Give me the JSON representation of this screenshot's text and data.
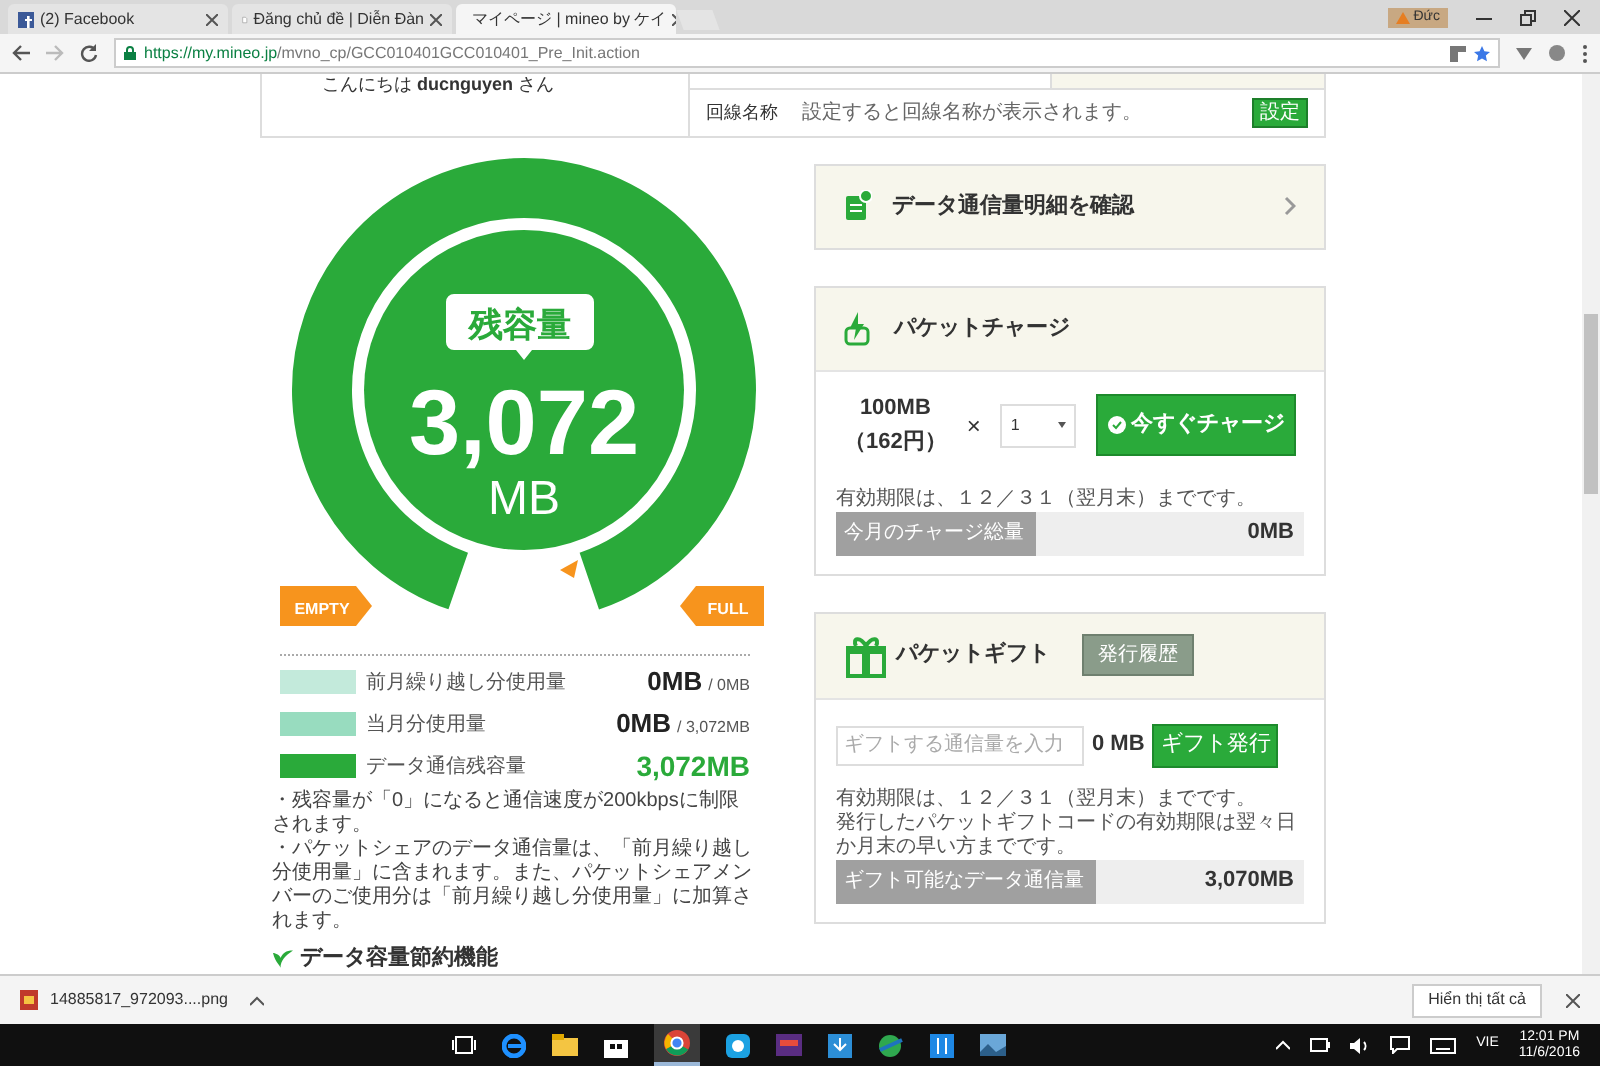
{
  "browser": {
    "tabs": [
      {
        "title": "(2) Facebook",
        "selected": false
      },
      {
        "title": "Đăng chủ đề | Diễn Đàn",
        "selected": false
      },
      {
        "title": "マイページ | mineo by ケイ",
        "selected": true
      }
    ],
    "profile": "Đức",
    "url_host": "https://my.mineo.jp",
    "url_path": "/mvno_cp/GCC010401GCC010401_Pre_Init.action"
  },
  "greeting": "こんにちは **ducnguyen** さん",
  "line_name": {
    "label": "回線名称",
    "value": "設定すると回線名称が表示されます。",
    "button": "設定"
  },
  "gauge": {
    "label": "残容量",
    "amount": "3,072",
    "unit": "MB",
    "empty": "EMPTY",
    "full": "FULL"
  },
  "legend": [
    {
      "label": "前月繰り越し分使用量",
      "value": "0MB",
      "total": "/ 0MB",
      "color": "#c3eadb",
      "highlight": false
    },
    {
      "label": "当月分使用量",
      "value": "0MB",
      "total": "/ 3,072MB",
      "color": "#98dcbf",
      "highlight": false
    },
    {
      "label": "データ通信残容量",
      "value": "3,072MB",
      "color": "#2aaa3a",
      "highlight": true
    }
  ],
  "notes": [
    "・残容量が「0」になると通信速度が200kbpsに制限されます。",
    "・パケットシェアのデータ通信量は、「前月繰り越し分使用量」に含まれます。また、パケットシェアメンバーのご使用分は「前月繰り越し分使用量」に加算されます。"
  ],
  "saving_heading": "データ容量節約機能",
  "usage_detail_link": "データ通信量明細を確認",
  "charge": {
    "title": "パケットチャージ",
    "unit_amount": "100MB",
    "unit_price": "（162円）",
    "times": "×",
    "quantity": "1",
    "button": "今すぐチャージ",
    "note": "有効期限は、１２／３１（翌月末）までです。",
    "total_label": "今月のチャージ総量",
    "total_value": "0MB"
  },
  "gift": {
    "title": "パケットギフト",
    "history_button": "発行履歴",
    "placeholder": "ギフトする通信量を入力",
    "amount": "0 MB",
    "button": "ギフト発行",
    "notes": [
      "有効期限は、１２／３１（翌月末）までです。",
      "発行したパケットギフトコードの有効期限は翌々日か月末の早い方までです。"
    ],
    "available_label": "ギフト可能なデータ通信量",
    "available_value": "3,070MB"
  },
  "downloads": {
    "file": "14885817_972093....png",
    "show_all": "Hiển thị tất cả"
  },
  "taskbar": {
    "language": "VIE",
    "time": "12:01 PM",
    "date": "11/6/2016"
  }
}
